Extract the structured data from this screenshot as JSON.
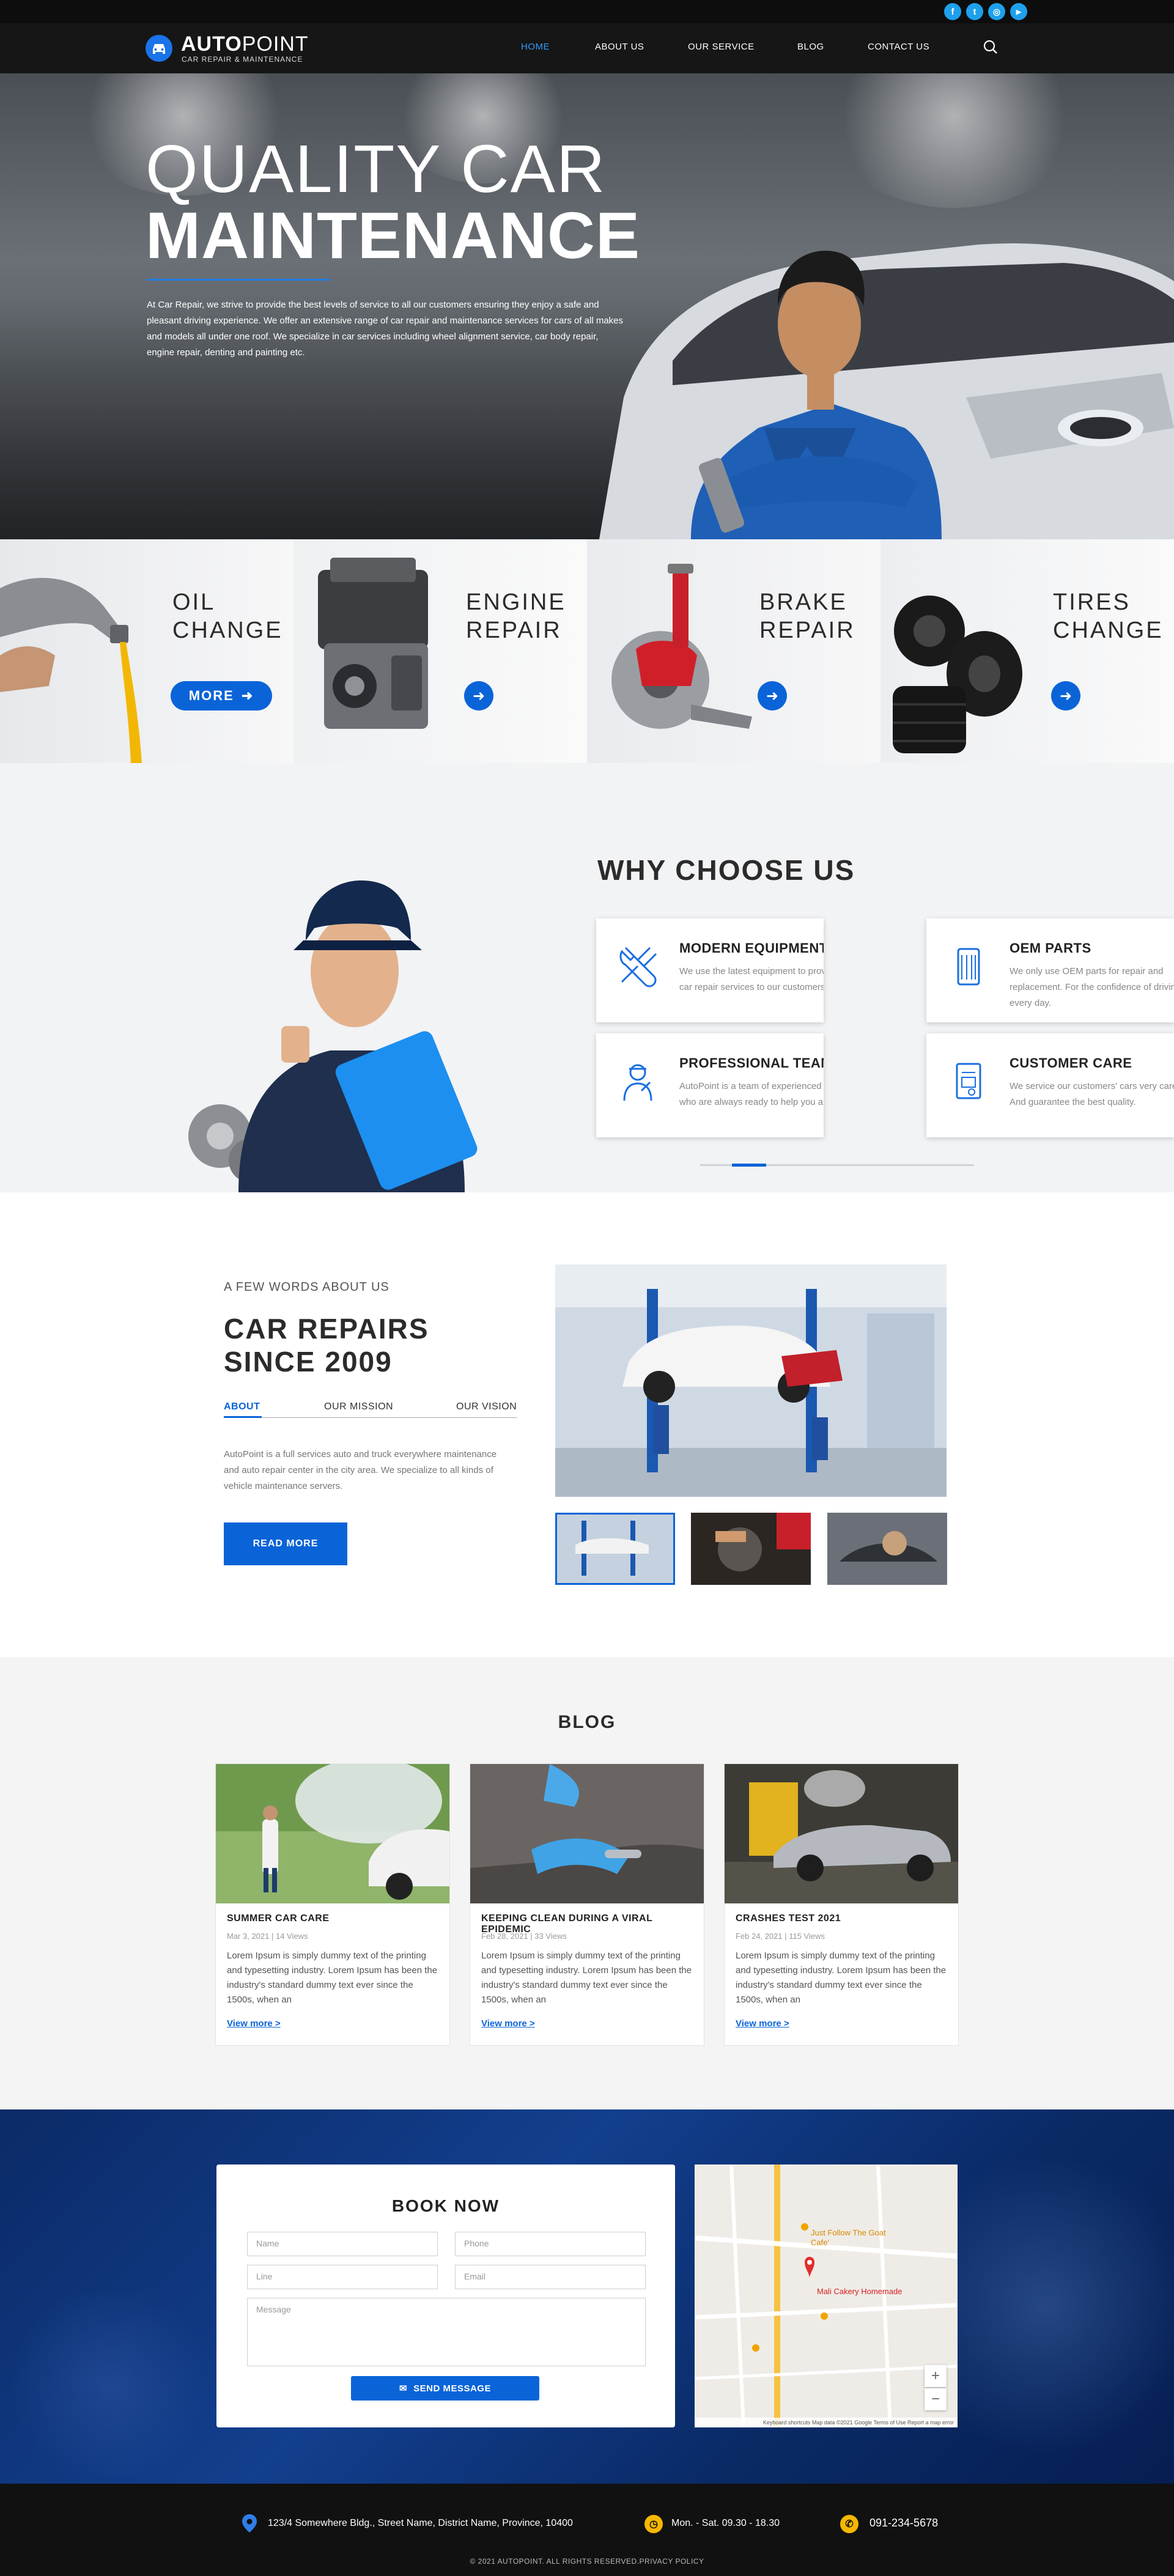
{
  "social": {
    "facebook": "f",
    "twitter": "t",
    "instagram": "◎",
    "youtube": "▶"
  },
  "brand": {
    "name_bold": "AUTO",
    "name_light": "POINT",
    "tagline": "CAR REPAIR & MAINTENANCE"
  },
  "nav": {
    "items": [
      {
        "label": "HOME"
      },
      {
        "label": "ABOUT US"
      },
      {
        "label": "OUR SERVICE"
      },
      {
        "label": "BLOG"
      },
      {
        "label": "CONTACT US"
      }
    ]
  },
  "hero": {
    "title_light": "QUALITY CAR",
    "title_bold": "MAINTENANCE",
    "description": "At Car Repair, we strive to provide the best levels of service to all our customers ensuring they enjoy a safe and pleasant driving experience. We offer an extensive range of car repair and maintenance services for cars of all makes and models all under one roof. We specialize in car services including wheel alignment service, car body repair, engine repair, denting and painting etc."
  },
  "services": {
    "oil": {
      "line1": "OIL",
      "line2": "CHANGE",
      "button": "MORE"
    },
    "engine": {
      "line1": "ENGINE",
      "line2": "REPAIR"
    },
    "brake": {
      "line1": "BRAKE",
      "line2": "REPAIR"
    },
    "tires": {
      "line1": "TIRES",
      "line2": "CHANGE"
    }
  },
  "why": {
    "title": "WHY CHOOSE US",
    "cards": [
      {
        "title": "MODERN EQUIPMENT",
        "desc": "We use the latest equipment to provide the best car repair services to our customers."
      },
      {
        "title": "OEM PARTS",
        "desc": "We only use OEM parts for repair and replacement. For the confidence of driving every day."
      },
      {
        "title": "PROFESSIONAL TEAM",
        "desc": "AutoPoint is a team of experienced car experts who are always ready to help you and your car."
      },
      {
        "title": "CUSTOMER CARE",
        "desc": "We service our customers' cars very carefully. And guarantee the best quality."
      }
    ]
  },
  "about": {
    "kicker": "A FEW WORDS ABOUT US",
    "heading_line1": "CAR REPAIRS",
    "heading_line2": "SINCE 2009",
    "tabs": [
      {
        "label": "ABOUT"
      },
      {
        "label": "OUR MISSION"
      },
      {
        "label": "OUR VISION"
      }
    ],
    "text": "AutoPoint is a full services auto and truck everywhere maintenance and auto repair center in the city area. We specialize to all kinds of vehicle maintenance servers.",
    "button": "READ MORE"
  },
  "blog": {
    "title": "BLOG",
    "posts": [
      {
        "title": "SUMMER CAR CARE",
        "meta": "Mar 3, 2021 | 14 Views",
        "excerpt": "Lorem Ipsum is simply dummy text of the printing and typesetting industry. Lorem Ipsum has been the industry's standard dummy text ever since the 1500s, when an",
        "link": "View more >"
      },
      {
        "title": "KEEPING CLEAN DURING A VIRAL EPIDEMIC",
        "meta": "Feb 28, 2021 | 33 Views",
        "excerpt": "Lorem Ipsum is simply dummy text of the printing and typesetting industry. Lorem Ipsum has been the industry's standard dummy text ever since the 1500s, when an",
        "link": "View more >"
      },
      {
        "title": "CRASHES TEST 2021",
        "meta": "Feb 24, 2021 | 115 Views",
        "excerpt": "Lorem Ipsum is simply dummy text of the printing and typesetting industry. Lorem Ipsum has been the industry's standard dummy text ever since the 1500s, when an",
        "link": "View more >"
      }
    ]
  },
  "booking": {
    "title": "BOOK NOW",
    "name_placeholder": "Name",
    "phone_placeholder": "Phone",
    "line_placeholder": "Line",
    "email_placeholder": "Email",
    "message_placeholder": "Message",
    "submit": "SEND MESSAGE"
  },
  "map": {
    "place1": "Just Follow The Goat Cafe'",
    "place2": "Mali Cakery Homemade",
    "zoom_in": "+",
    "zoom_out": "−",
    "attribution": "Keyboard shortcuts  Map data ©2021 Google  Terms of Use  Report a map error"
  },
  "footer": {
    "address": "123/4 Somewhere Bldg., Street Name, District Name, Province, 10400",
    "hours": "Mon. - Sat.  09.30 - 18.30",
    "phone": "091-234-5678",
    "copyright": "© 2021 AUTOPOINT. ALL RIGHTS RESERVED.PRIVACY POLICY"
  },
  "colors": {
    "accent": "#0a64d8",
    "nav_active": "#2f9bff",
    "footer_icon": "#f5b800",
    "social": "#1ea0ec"
  }
}
